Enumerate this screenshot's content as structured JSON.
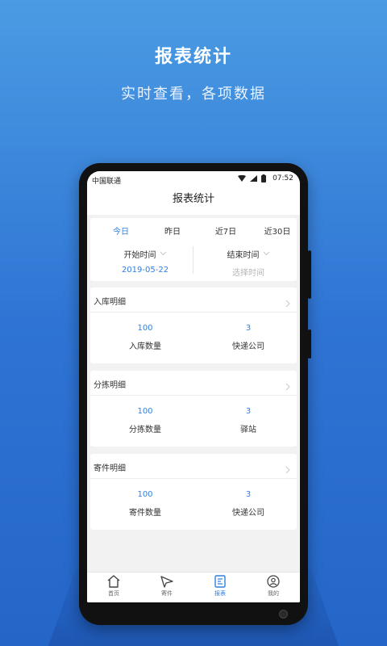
{
  "promo": {
    "title": "报表统计",
    "subtitle": "实时查看，各项数据"
  },
  "status_bar": {
    "carrier": "中国联通",
    "time": "07:52",
    "icons": [
      "wifi-icon",
      "signal-icon",
      "battery-icon"
    ]
  },
  "header": {
    "title": "报表统计"
  },
  "filter": {
    "tabs": [
      {
        "label": "今日",
        "active": true
      },
      {
        "label": "昨日",
        "active": false
      },
      {
        "label": "近7日",
        "active": false
      },
      {
        "label": "近30日",
        "active": false
      }
    ],
    "start": {
      "label": "开始时间",
      "value": "2019-05-22"
    },
    "end": {
      "label": "结束时间",
      "placeholder": "选择时间"
    }
  },
  "sections": [
    {
      "title": "入库明细",
      "stats": [
        {
          "value": "100",
          "label": "入库数量"
        },
        {
          "value": "3",
          "label": "快递公司"
        }
      ]
    },
    {
      "title": "分拣明细",
      "stats": [
        {
          "value": "100",
          "label": "分拣数量"
        },
        {
          "value": "3",
          "label": "驿站"
        }
      ]
    },
    {
      "title": "寄件明细",
      "stats": [
        {
          "value": "100",
          "label": "寄件数量"
        },
        {
          "value": "3",
          "label": "快递公司"
        }
      ]
    }
  ],
  "bottom_nav": [
    {
      "label": "首页",
      "icon": "home-icon",
      "active": false
    },
    {
      "label": "寄件",
      "icon": "send-plane-icon",
      "active": false
    },
    {
      "label": "报表",
      "icon": "report-icon",
      "active": true
    },
    {
      "label": "我的",
      "icon": "user-icon",
      "active": false
    }
  ],
  "colors": {
    "accent": "#2f80e4",
    "background_top": "#4a9be3",
    "background_bottom": "#2466c8",
    "placeholder": "#b5b5b5"
  }
}
